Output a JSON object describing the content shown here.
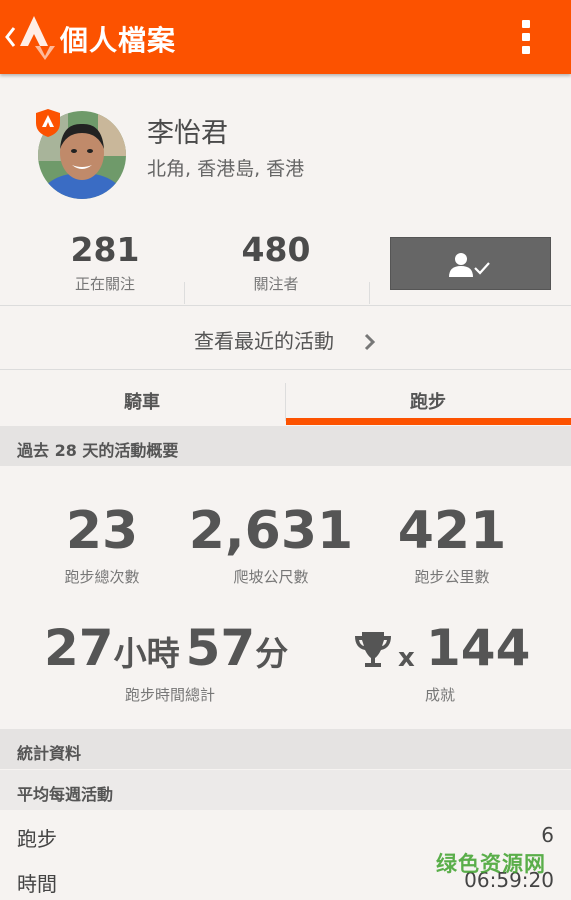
{
  "appbar": {
    "title": "個人檔案",
    "back_icon": "chevron-left-icon",
    "logo_icon": "strava-logo-icon",
    "menu_icon": "overflow-menu-icon"
  },
  "profile": {
    "name": "李怡君",
    "location": "北角, 香港島, 香港",
    "badge_icon": "premium-badge-icon"
  },
  "follow": {
    "following_count": "281",
    "following_label": "正在關注",
    "followers_count": "480",
    "followers_label": "關注者",
    "button_icon": "user-following-icon"
  },
  "recent_activity_label": "查看最近的活動",
  "tabs": [
    {
      "label": "騎車",
      "active": false
    },
    {
      "label": "跑步",
      "active": true
    }
  ],
  "summary": {
    "header": "過去 28 天的活動概要",
    "runs": "23",
    "runs_label": "跑步總次數",
    "elevation": "2,631",
    "elevation_label": "爬坡公尺數",
    "distance": "421",
    "distance_label": "跑步公里數",
    "hours": "27",
    "hours_unit": "小時",
    "minutes": "57",
    "minutes_unit": "分",
    "time_label": "跑步時間總計",
    "achievements_prefix": "x",
    "achievements": "144",
    "achievements_label": "成就",
    "trophy_icon": "trophy-icon"
  },
  "stats": {
    "header": "統計資料",
    "weekly_header": "平均每週活動",
    "rows": [
      {
        "label": "跑步",
        "value": "6"
      },
      {
        "label": "時間",
        "value": "06:59:20"
      }
    ]
  },
  "watermark": "绿色资源网",
  "colors": {
    "brand": "#fc5200",
    "background": "#f6f3f1",
    "section_header": "#e5e3e2"
  }
}
